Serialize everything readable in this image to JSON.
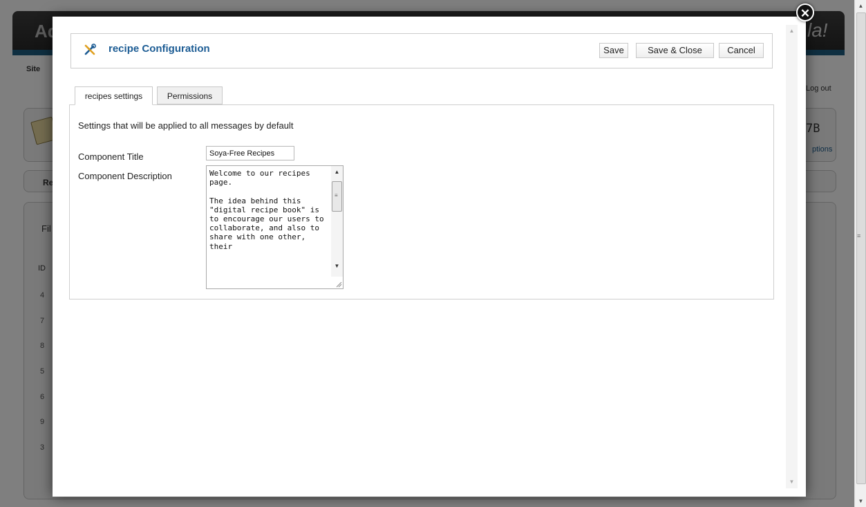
{
  "background": {
    "logo_left": "Ad",
    "logo_right": "la!",
    "site_label": "Site",
    "logout_label": "Log out",
    "options_label": "ptions",
    "icon_text": "7B",
    "re_label": "Re",
    "fi_label": "Fil",
    "id_header": "ID",
    "row_ids": [
      "4",
      "7",
      "8",
      "5",
      "6",
      "9",
      "3"
    ]
  },
  "modal": {
    "title": "recipe Configuration",
    "toolbar": {
      "save": "Save",
      "save_close": "Save & Close",
      "cancel": "Cancel"
    },
    "tabs": [
      {
        "label": "recipes settings",
        "active": true
      },
      {
        "label": "Permissions",
        "active": false
      }
    ],
    "description": "Settings that will be applied to all messages by default",
    "fields": {
      "component_title_label": "Component Title",
      "component_title_value": "Soya-Free Recipes",
      "component_description_label": "Component Description",
      "component_description_value": "Welcome to our recipes page.\n\nThe idea behind this \"digital recipe book\" is to encourage our users to collaborate, and also to share with one other, their"
    }
  },
  "colors": {
    "title_blue": "#1c5c94",
    "header_stripe": "#1e5f82"
  },
  "icons": {
    "close": "close-circle-icon",
    "title": "wrench-screwdriver-icon"
  }
}
